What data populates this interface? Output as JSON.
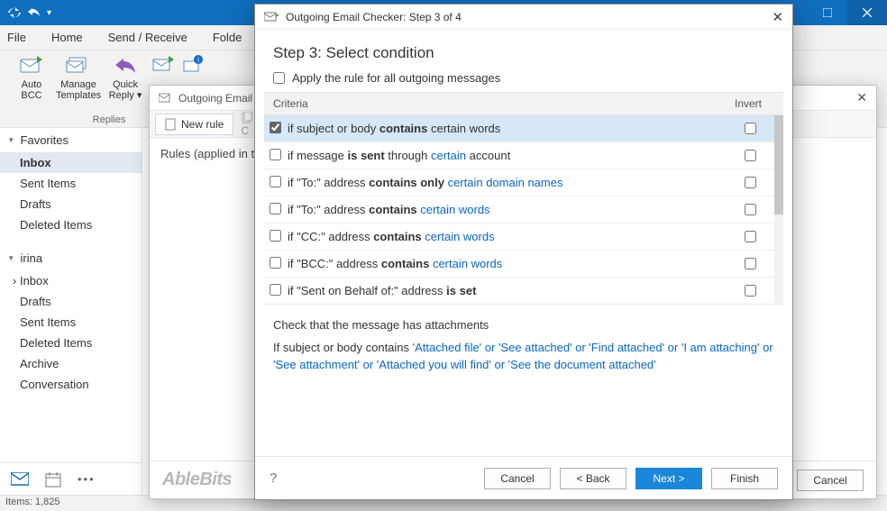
{
  "titlebar": {
    "qat_icons": [
      "sync-icon",
      "undo-icon",
      "dropdown-icon"
    ]
  },
  "menubar": {
    "items": [
      "File",
      "Home",
      "Send / Receive",
      "Folde"
    ]
  },
  "ribbon": {
    "group_caption": "Replies",
    "buttons": [
      {
        "line1": "Auto",
        "line2": "BCC"
      },
      {
        "line1": "Manage",
        "line2": "Templates"
      },
      {
        "line1": "Quick",
        "line2": "Reply ▾"
      }
    ]
  },
  "nav": {
    "favorites_label": "Favorites",
    "favorites": [
      "Inbox",
      "Sent Items",
      "Drafts",
      "Deleted Items"
    ],
    "account_label": "irina",
    "account_items": [
      "Inbox",
      "Drafts",
      "Sent Items",
      "Deleted Items",
      "Archive",
      "Conversation"
    ]
  },
  "status": {
    "items_label": "Items: 1,825"
  },
  "under": {
    "title": "Outgoing Email",
    "new_rule": "New rule",
    "caption": "Rules (applied in the",
    "logo": "AbleBits",
    "cancel": "Cancel"
  },
  "dialog": {
    "title": "Outgoing Email Checker: Step 3 of 4",
    "step": "Step 3: Select condition",
    "apply_all": "Apply the rule for all outgoing messages",
    "col_criteria": "Criteria",
    "col_invert": "Invert",
    "rows": [
      {
        "checked": true,
        "pre": "if subject or body ",
        "bold": "contains",
        "post": " certain words"
      },
      {
        "checked": false,
        "pre": "if message ",
        "bold": "is sent",
        "post": " through ",
        "link": "certain",
        "tail": " account"
      },
      {
        "checked": false,
        "pre": "if \"To:\" address ",
        "bold": "contains only ",
        "link": "certain domain names"
      },
      {
        "checked": false,
        "pre": "if \"To:\" address ",
        "bold": "contains ",
        "link": "certain words"
      },
      {
        "checked": false,
        "pre": "if \"CC:\" address ",
        "bold": "contains ",
        "link": "certain words"
      },
      {
        "checked": false,
        "pre": "if \"BCC:\" address ",
        "bold": "contains ",
        "link": "certain words"
      },
      {
        "checked": false,
        "pre": "if \"Sent on Behalf of:\" address ",
        "bold": "is set"
      }
    ],
    "desc_title": "Check that the message has attachments",
    "desc_pre": "If subject or body contains ",
    "desc_link": "'Attached file' or 'See attached' or 'Find attached' or 'I am attaching' or 'See attachment' or 'Attached you will find' or 'See the document attached'",
    "help": "?",
    "btn_cancel": "Cancel",
    "btn_back": "<  Back",
    "btn_next": "Next  >",
    "btn_finish": "Finish"
  }
}
